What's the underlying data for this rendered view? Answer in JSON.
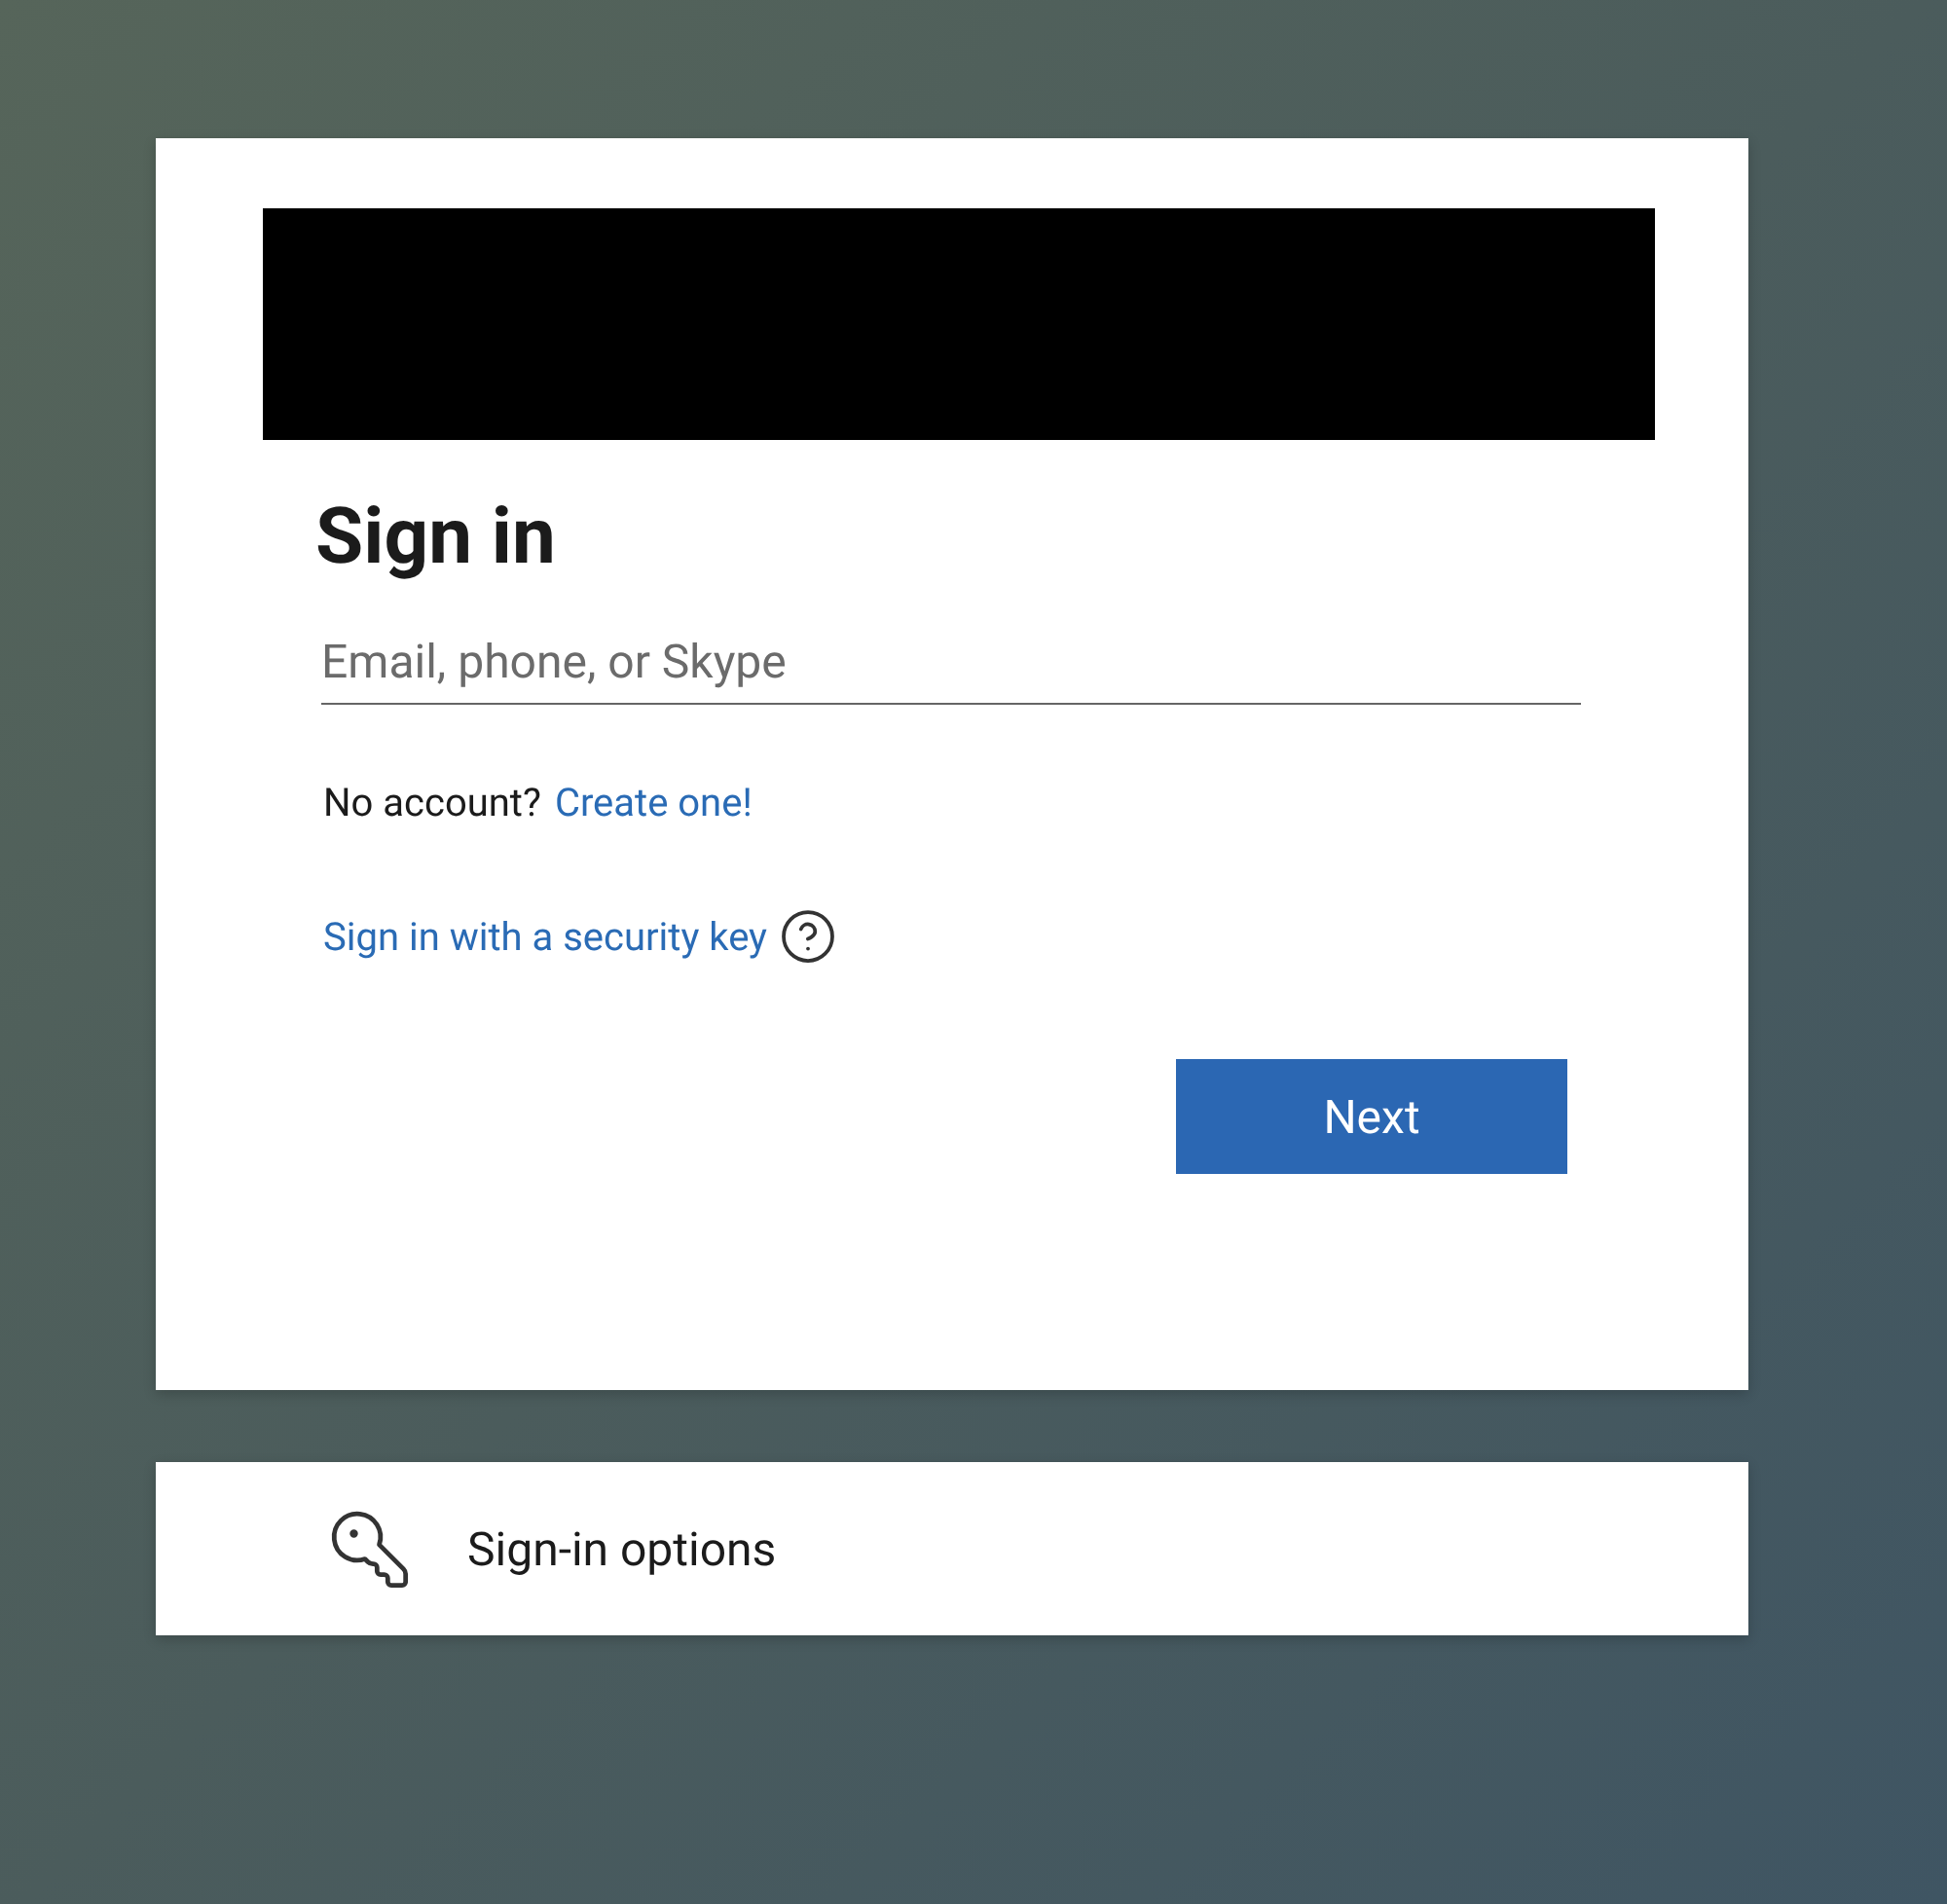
{
  "sign_in_card": {
    "title": "Sign in",
    "email_field": {
      "placeholder": "Email, phone, or Skype"
    },
    "no_account": {
      "text": "No account?",
      "link": "Create one!"
    },
    "security_key_link": "Sign in with a security key",
    "next_button": "Next"
  },
  "options_card": {
    "label": "Sign-in options"
  }
}
